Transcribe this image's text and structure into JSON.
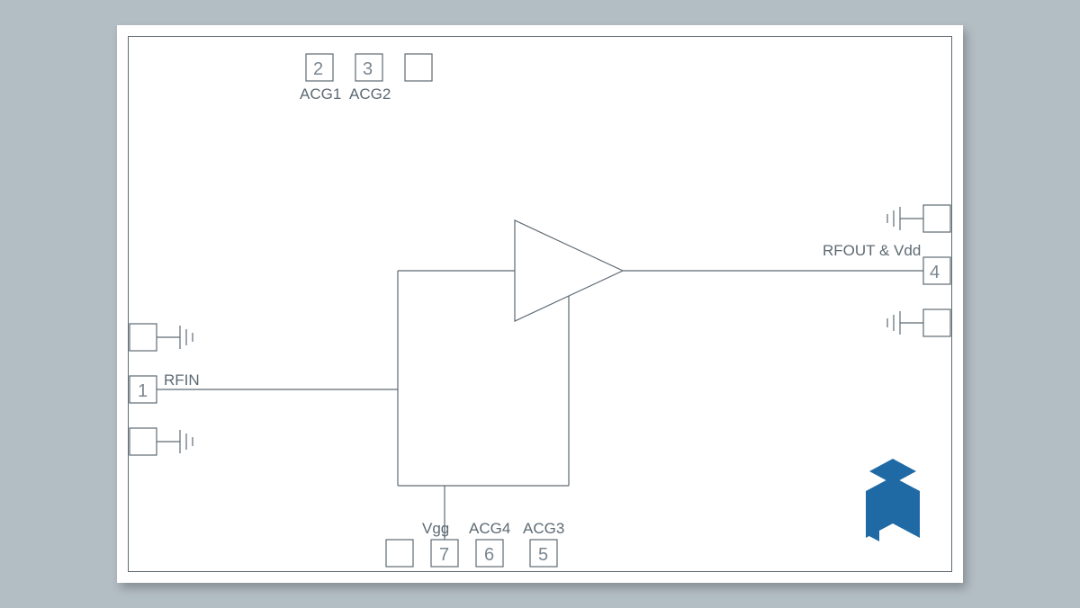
{
  "pads": {
    "p1": {
      "num": "1",
      "label": "RFIN"
    },
    "p2": {
      "num": "2",
      "label": "ACG1"
    },
    "p3": {
      "num": "3",
      "label": "ACG2"
    },
    "p4": {
      "num": "4",
      "label": "RFOUT & Vdd"
    },
    "p5": {
      "num": "5",
      "label": "ACG3"
    },
    "p6": {
      "num": "6",
      "label": "ACG4"
    },
    "p7": {
      "num": "7",
      "label": "Vgg"
    }
  }
}
